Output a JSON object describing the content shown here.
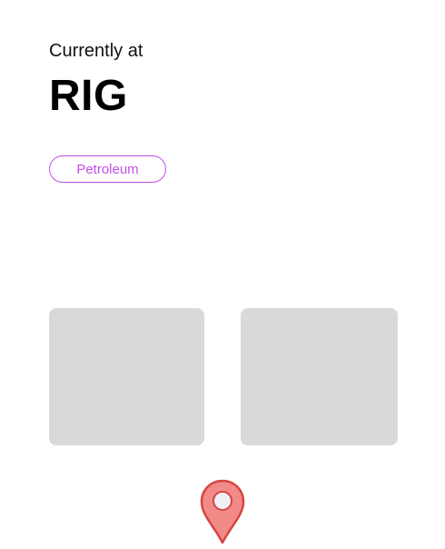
{
  "header": {
    "subtitle": "Currently at",
    "location": "RIG"
  },
  "tag": {
    "label": "Petroleum",
    "color": "#c44ee8"
  },
  "cards": [
    {
      "name": "card-1",
      "color": "#d9d9d9"
    },
    {
      "name": "card-2",
      "color": "#d9d9d9"
    }
  ],
  "map_pin": {
    "icon": "location-pin-icon",
    "fill": "#f28b87",
    "stroke": "#d64541"
  }
}
